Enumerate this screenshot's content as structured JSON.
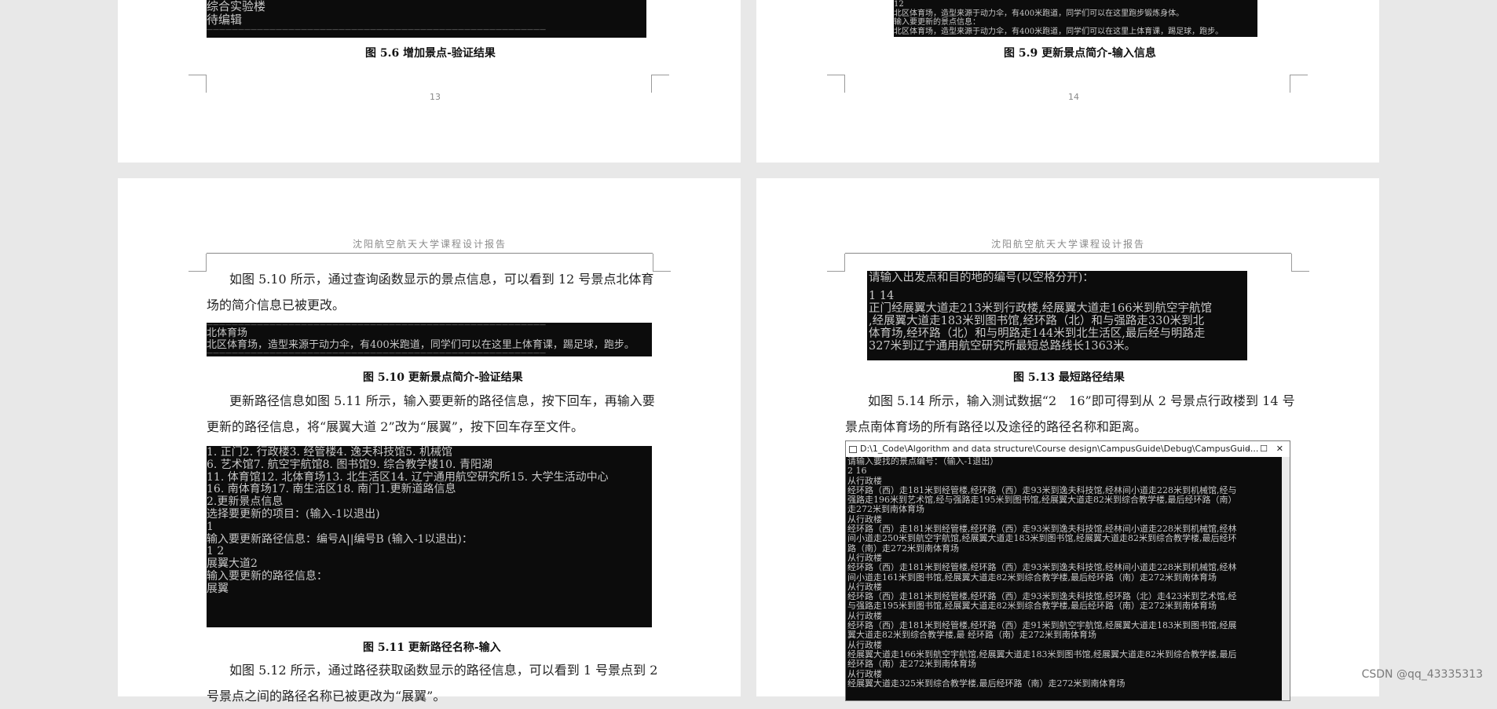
{
  "page13": {
    "console_lines": [
      "综合实验楼",
      "待编辑",
      "——————————————————————————————————————————————————————"
    ],
    "caption": "图 5.6 增加景点-验证结果",
    "page_number": "13"
  },
  "page14": {
    "console_lines": [
      "12",
      "北区体育场，造型来源于动力伞，有400米跑道，同学们可以在这里跑步锻炼身体。",
      "输入要更新的景点信息：",
      "北区体育场，造型来源于动力伞，有400米跑道，同学们可以在这里上体育课，踢足球，跑步。"
    ],
    "caption": "图 5.9 更新景点简介-输入信息",
    "page_number": "14"
  },
  "page15": {
    "header": "沈阳航空航天大学课程设计报告",
    "para1_line1": "如图 5.10 所示，通过查询函数显示的景点信息，可以看到 12 号景点北体育",
    "para1_line2": "场的简介信息已被更改。",
    "console1_lines": [
      "——————————————————————————————————————————————————————",
      "北体育场",
      "北区体育场，造型来源于动力伞，有400米跑道，同学们可以在这里上体育课，踢足球，跑步。",
      "——————————————————————————————————————————————————————"
    ],
    "caption1": "图 5.10 更新景点简介-验证结果",
    "para2_line1": "更新路径信息如图 5.11 所示，输入要更新的路径信息，按下回车，再输入要",
    "para2_line2": "更新的路径信息，将“展翼大道 2”改为“展翼”，按下回车存至文件。",
    "console2_lines": [
      "1. 正门2. 行政楼3. 经管楼4. 逸夫科技馆5. 机械馆",
      "6. 艺术馆7. 航空宇航馆8. 图书馆9. 综合教学楼10. 青阳湖",
      "11. 体育馆12. 北体育场13. 北生活区14. 辽宁通用航空研究所15. 大学生活动中心",
      "16. 南体育场17. 南生活区18. 南门1.更新道路信息",
      "2.更新景点信息",
      "选择要更新的项目：(输入-1以退出)",
      "1",
      "输入要更新路径信息：编号A||编号B (输入-1以退出)：",
      "1 2",
      "展翼大道2",
      "输入要更新的路径信息：",
      "展翼"
    ],
    "caption2": "图 5.11 更新路径名称-输入",
    "para3_line1": "如图 5.12 所示，通过路径获取函数显示的路径信息，可以看到 1 号景点到 2",
    "para3_line2": "号景点之间的路径名称已被更改为“展翼”。"
  },
  "page16": {
    "header": "沈阳航空航天大学课程设计报告",
    "console1_lines": [
      "请输入出发点和目的地的编号(以空格分开)：",
      "",
      "1 14",
      "正门经展翼大道走213米到行政楼,经展翼大道走166米到航空宇航馆",
      ",经展翼大道走183米到图书馆,经环路（北）和与强路走330米到北",
      "体育场,经环路（北）和与明路走144米到北生活区,最后经与明路走",
      "327米到辽宁通用航空研究所最短总路线长1363米。"
    ],
    "caption1": "图 5.13 最短路径结果",
    "para1_line1": "如图 5.14 所示，输入测试数据“2　16”即可得到从 2 号景点行政楼到 14 号",
    "para1_line2": "景点南体育场的所有路径以及途径的路径名称和距离。",
    "window": {
      "title": "D:\\1_Code\\Algorithm and data structure\\Course design\\CampusGuide\\Debug\\CampusGuid...",
      "minimize": "–",
      "maximize": "☐",
      "close": "✕",
      "lines": [
        "请输入要找的景点编号：（输入-1退出）",
        "2 16",
        "从行政楼",
        "经环路（西）走181米到经管楼,经环路（西）走93米到逸夫科技馆,经林间小道走228米到机械馆,经与",
        "强路走196米到艺术馆,经与强路走195米到图书馆,经展翼大道走82米到综合教学楼,最后经环路（南）",
        "走272米到南体育场",
        "从行政楼",
        "经环路（西）走181米到经管楼,经环路（西）走93米到逸夫科技馆,经林间小道走228米到机械馆,经林",
        "间小道走250米到航空宇航馆,经展翼大道走183米到图书馆,经展翼大道走82米到综合教学楼,最后经环",
        "路（南）走272米到南体育场",
        "从行政楼",
        "经环路（西）走181米到经管楼,经环路（西）走93米到逸夫科技馆,经林间小道走228米到机械馆,经林",
        "间小道走161米到图书馆,经展翼大道走82米到综合教学楼,最后经环路（南）走272米到南体育场",
        "从行政楼",
        "经环路（西）走181米到经管楼,经环路（西）走93米到逸夫科技馆,经环路（北）走423米到艺术馆,经",
        "与强路走195米到图书馆,经展翼大道走82米到综合教学楼,最后经环路（南）走272米到南体育场",
        "从行政楼",
        "经环路（西）走181米到经管楼,经环路（西）走91米到航空宇航馆,经展翼大道走183米到图书馆,经展",
        "翼大道走82米到综合教学楼,最 经环路（南）走272米到南体育场",
        "从行政楼",
        "经展翼大道走166米到航空宇航馆,经展翼大道走183米到图书馆,经展翼大道走82米到综合教学楼,最后",
        "经环路（南）走272米到南体育场",
        "从行政楼",
        "经展翼大道走325米到综合教学楼,最后经环路（南）走272米到南体育场"
      ]
    }
  },
  "watermark": "CSDN @qq_43335313"
}
